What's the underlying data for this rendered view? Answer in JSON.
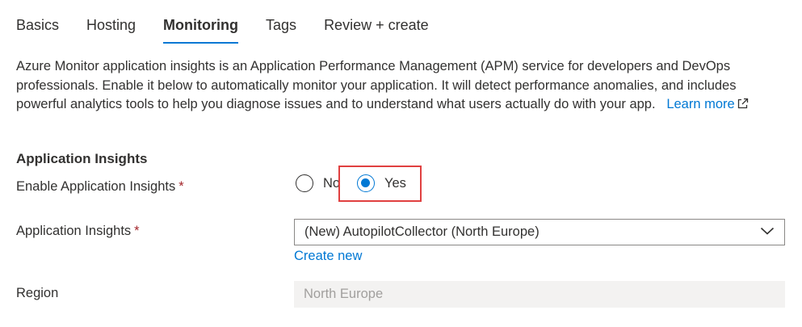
{
  "tabs": [
    {
      "label": "Basics",
      "active": false
    },
    {
      "label": "Hosting",
      "active": false
    },
    {
      "label": "Monitoring",
      "active": true
    },
    {
      "label": "Tags",
      "active": false
    },
    {
      "label": "Review + create",
      "active": false
    }
  ],
  "description": {
    "text": "Azure Monitor application insights is an Application Performance Management (APM) service for developers and DevOps professionals. Enable it below to automatically monitor your application. It will detect performance anomalies, and includes powerful analytics tools to help you diagnose issues and to understand what users actually do with your app.",
    "link_label": "Learn more",
    "link_icon": "external-link-icon"
  },
  "section": {
    "title": "Application Insights"
  },
  "enable_field": {
    "label": "Enable Application Insights",
    "required_mark": "*",
    "options": [
      {
        "label": "No",
        "selected": false
      },
      {
        "label": "Yes",
        "selected": true
      }
    ]
  },
  "insights_field": {
    "label": "Application Insights",
    "required_mark": "*",
    "value": "(New) AutopilotCollector (North Europe)",
    "create_new_label": "Create new",
    "icon": "chevron-down-icon"
  },
  "region_field": {
    "label": "Region",
    "value": "North Europe",
    "disabled": true
  },
  "colors": {
    "accent": "#0078d4",
    "required": "#a4262c",
    "highlight": "#e04040",
    "disabled_bg": "#f3f2f1"
  }
}
